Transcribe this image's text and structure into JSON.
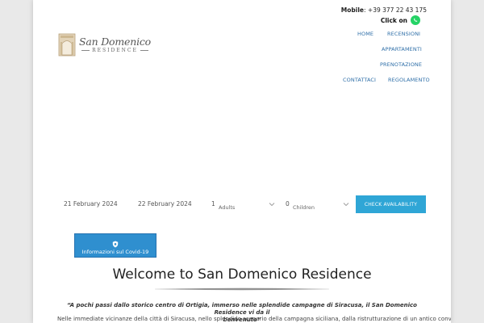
{
  "header": {
    "logo": {
      "name": "San Domenico",
      "sub": "RESIDENCE"
    },
    "contact": {
      "label": "Mobile",
      "number": "+39 377 22 43 175"
    },
    "click_on": "Click on"
  },
  "nav": {
    "home": "HOME",
    "reviews": "RECENSIONI",
    "apartments": "APPARTAMENTI",
    "booking": "PRENOTAZIONE",
    "contacts": "CONTATTACI",
    "rules": "REGOLAMENTO"
  },
  "booking": {
    "checkin": "21 February 2024",
    "checkout": "22 February 2024",
    "adults_count": "1",
    "adults_label": "Adults",
    "children_count": "0",
    "children_label": "Children",
    "button": "CHECK AVAILABILITY"
  },
  "covid": {
    "label": "Informazioni sul Covid-19"
  },
  "welcome": {
    "title": "Welcome to San Domenico Residence",
    "quote_line1": "“A pochi passi dallo storico centro di Ortigia, immerso nelle splendide campagne di Siracusa, il San Domenico Residence vi da il",
    "quote_line2": "benvenuto”",
    "paragraph": "Nelle immediate vicinanze della città di Siracusa, nello splendido scenario della campagna siciliana, dalla ristrutturazione di un antico convento dei"
  },
  "colors": {
    "accent": "#2fa6d6",
    "nav": "#2f6fa8",
    "whatsapp": "#25d366"
  }
}
